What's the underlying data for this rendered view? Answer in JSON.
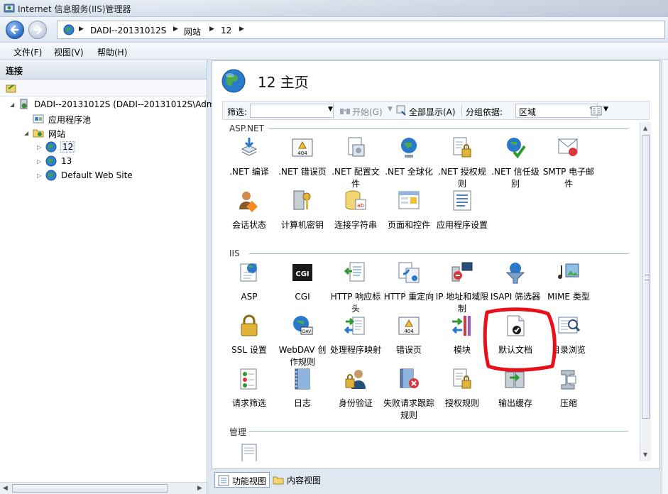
{
  "window": {
    "title": "Internet 信息服务(IIS)管理器"
  },
  "address": {
    "crumbs": [
      "DADI--20131012S",
      "网站",
      "12"
    ]
  },
  "menu": {
    "items": [
      "文件(F)",
      "视图(V)",
      "帮助(H)"
    ]
  },
  "connections": {
    "header": "连接",
    "tree": {
      "server": "DADI--20131012S (DADI--20131012S\\Adm",
      "app_pools": "应用程序池",
      "sites": "网站",
      "site_items": [
        "12",
        "13",
        "Default Web Site"
      ]
    }
  },
  "main": {
    "title": "12 主页",
    "filter_label": "筛选:",
    "start_label": "开始(G)",
    "show_all_label": "全部显示(A)",
    "groupby_label": "分组依据:",
    "groupby_value": "区域",
    "sections": [
      {
        "title": "ASP.NET",
        "features": [
          ".NET 编译",
          ".NET 错误页",
          ".NET 配置文件",
          ".NET 全球化",
          ".NET 授权规则",
          ".NET 信任级别",
          "SMTP 电子邮件",
          "会话状态",
          "计算机密钥",
          "连接字符串",
          "页面和控件",
          "应用程序设置"
        ]
      },
      {
        "title": "IIS",
        "features": [
          "ASP",
          "CGI",
          "HTTP 响应标头",
          "HTTP 重定向",
          "IP 地址和域限制",
          "ISAPI 筛选器",
          "MIME 类型",
          "SSL 设置",
          "WebDAV 创作规则",
          "处理程序映射",
          "错误页",
          "模块",
          "默认文档",
          "目录浏览",
          "请求筛选",
          "日志",
          "身份验证",
          "失败请求跟踪规则",
          "授权规则",
          "输出缓存",
          "压缩"
        ]
      },
      {
        "title": "管理",
        "features": []
      }
    ]
  },
  "bottom_tabs": [
    "功能视图",
    "内容视图"
  ],
  "colors": {
    "annotation": "#e8101a",
    "accent": "#2a6cc3"
  }
}
